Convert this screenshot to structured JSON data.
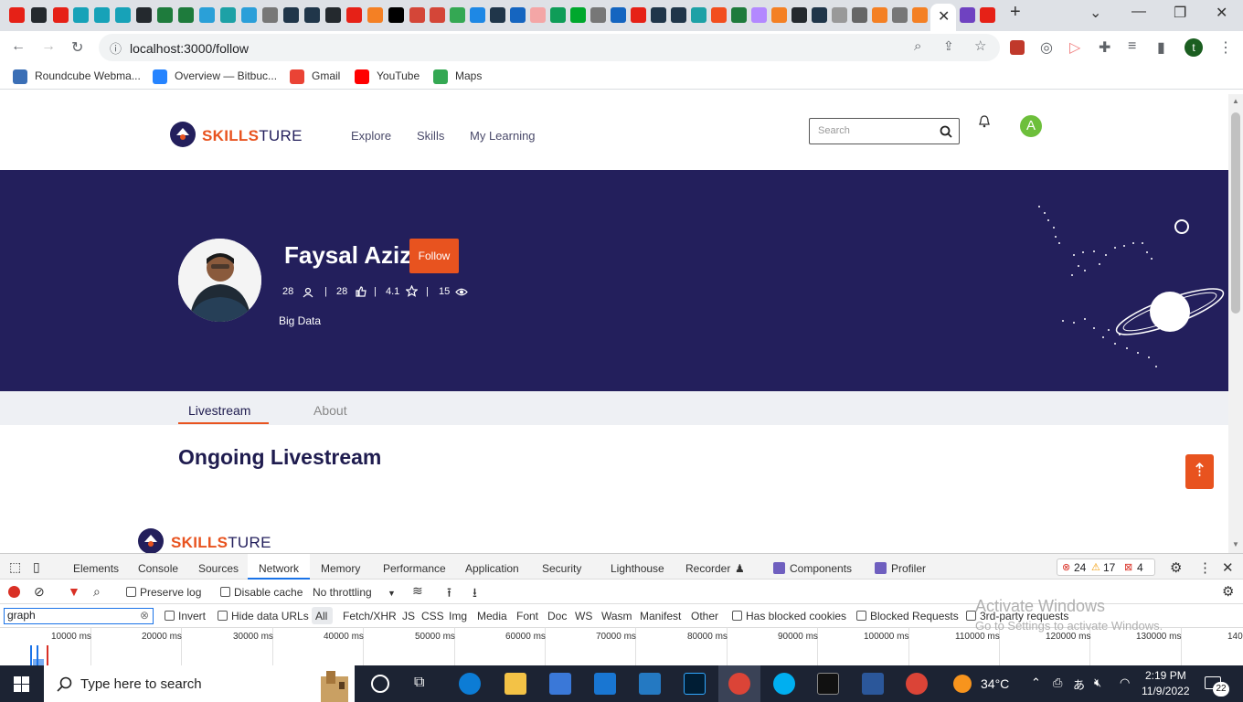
{
  "browser": {
    "url": "localhost:3000/follow",
    "active_tab_close": "✕",
    "new_tab": "+",
    "profile_initial": "t",
    "bookmarks": [
      {
        "label": "Roundcube Webma...",
        "color": "#3b6fb6"
      },
      {
        "label": "Overview — Bitbuc...",
        "color": "#2684ff"
      },
      {
        "label": "Gmail",
        "color": "#ea4335"
      },
      {
        "label": "YouTube",
        "color": "#ff0000"
      },
      {
        "label": "Maps",
        "color": "#34a853"
      }
    ]
  },
  "site": {
    "brand_bold": "SKILLS",
    "brand_light": "TURE",
    "nav": [
      "Explore",
      "Skills",
      "My Learning"
    ],
    "search_placeholder": "Search",
    "user_initial": "A",
    "accent": "#e8531f",
    "navy": "#231f5c"
  },
  "profile": {
    "name": "Faysal Aziz",
    "follow_label": "Follow",
    "stats": [
      {
        "value": "28",
        "icon": "users-icon"
      },
      {
        "value": "28",
        "icon": "thumbs-up-icon"
      },
      {
        "value": "4.1",
        "icon": "star-icon"
      },
      {
        "value": "15",
        "icon": "eye-icon"
      }
    ],
    "separator": "|",
    "headline": "Big Data"
  },
  "tabs": [
    "Livestream",
    "About"
  ],
  "section_title": "Ongoing Livestream",
  "footer_brand": {
    "bold": "SKILLS",
    "light": "TURE"
  },
  "devtools": {
    "tabs": [
      "Elements",
      "Console",
      "Sources",
      "Network",
      "Memory",
      "Performance",
      "Application",
      "Security",
      "Lighthouse",
      "Recorder",
      "Components",
      "Profiler"
    ],
    "active_tab": "Network",
    "errors": "24",
    "warnings": "17",
    "issues": "4",
    "preserve_log": "Preserve log",
    "disable_cache": "Disable cache",
    "throttling": "No throttling",
    "filter_value": "graph",
    "invert": "Invert",
    "hide_data_urls": "Hide data URLs",
    "types": [
      "All",
      "Fetch/XHR",
      "JS",
      "CSS",
      "Img",
      "Media",
      "Font",
      "Doc",
      "WS",
      "Wasm",
      "Manifest",
      "Other"
    ],
    "has_blocked_cookies": "Has blocked cookies",
    "blocked_requests": "Blocked Requests",
    "third_party": "3rd-party requests",
    "ticks": [
      "10000 ms",
      "20000 ms",
      "30000 ms",
      "40000 ms",
      "50000 ms",
      "60000 ms",
      "70000 ms",
      "80000 ms",
      "90000 ms",
      "100000 ms",
      "110000 ms",
      "120000 ms",
      "130000 ms",
      "140"
    ]
  },
  "watermark": {
    "line1": "Activate Windows",
    "line2": "Go to Settings to activate Windows."
  },
  "taskbar": {
    "search_placeholder": "Type here to search",
    "temperature": "34°C",
    "time": "2:19 PM",
    "date": "11/9/2022",
    "notifications": "22"
  }
}
